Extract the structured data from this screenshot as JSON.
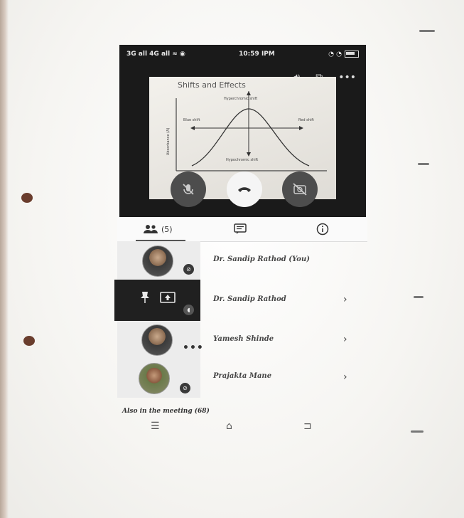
{
  "status_bar": {
    "left": "3G all 4G all ≈ ◉",
    "time": "10:59 IPM"
  },
  "video": {
    "slide_title": "Shifts and Effects",
    "slide_labels": {
      "top": "Hyperchromic shift",
      "left": "Blue shift",
      "right": "Red shift",
      "bottom": "Hypochromic shift",
      "yaxis": "Absorbance (A)"
    }
  },
  "tabs": {
    "people_count": "(5)"
  },
  "participants": [
    {
      "name": "Dr. Sandip Rathod (You)",
      "has_chevron": false
    },
    {
      "name": "Dr. Sandip Rathod",
      "has_chevron": true
    },
    {
      "name": "Yamesh Shinde",
      "has_chevron": true
    },
    {
      "name": "Prajakta Mane",
      "has_chevron": true
    }
  ],
  "also_in_meeting": "Also in the meeting (68)",
  "icons": {
    "volume": "volume-icon",
    "switch_camera": "switch-camera-icon",
    "more": "more-options-icon",
    "mute": "mic-off-icon",
    "end_call": "end-call-icon",
    "camera_off": "camera-off-icon",
    "people": "people-icon",
    "chat": "chat-icon",
    "info": "info-icon",
    "nav_menu": "menu-icon",
    "nav_home": "home-icon",
    "nav_back": "back-icon"
  },
  "colors": {
    "video_bg": "#1a1a1a",
    "end_button": "#f5f5f5",
    "control_button": "#4d4d4d"
  }
}
